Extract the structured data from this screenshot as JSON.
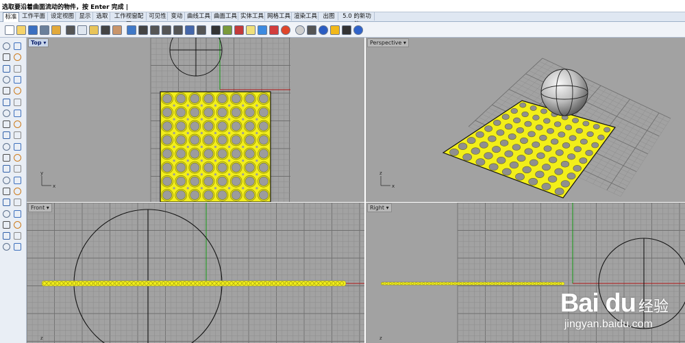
{
  "command_line": {
    "prompt": "选取要沿着曲面流动的物件，按 Enter 完成 |"
  },
  "tabs": [
    "标准",
    "工作平面",
    "设定视图",
    "显示",
    "选取",
    "工作视窗配置",
    "可见性",
    "变动",
    "曲线工具",
    "曲面工具",
    "实体工具",
    "网格工具",
    "渲染工具",
    "出图",
    "5.0 的新功能"
  ],
  "active_tab": "标准",
  "toolbar_icons": [
    "new-icon",
    "open-icon",
    "save-icon",
    "print-icon",
    "import-icon",
    "cut-icon",
    "copy-icon",
    "paste-icon",
    "undo-icon",
    "pan-hand-icon",
    "rotate-view-icon",
    "zoom-icon",
    "zoom-window-icon",
    "zoom-extents-icon",
    "zoom-selected-icon",
    "undo-view-icon",
    "set-view-icon",
    "camera-icon",
    "named-view-icon",
    "select-icon",
    "light-bulb-icon",
    "lock-icon",
    "layer-icon",
    "color-wheel-icon",
    "material-ball-icon",
    "render-icon",
    "rendered-sphere-icon",
    "curve-tools-icon",
    "grid-snap-icon",
    "help-icon"
  ],
  "toolbar_colors": [
    "#ffffff",
    "#f5d36a",
    "#3a6fc1",
    "#6a7f9a",
    "#e2a93b",
    "#555555",
    "#dfe6ef",
    "#e8c45a",
    "#444444",
    "#c9956a",
    "#3f78c7",
    "#444444",
    "#555555",
    "#555555",
    "#555555",
    "#4466aa",
    "#555555",
    "#333333",
    "#7a9a3b",
    "#c23a3a",
    "#f0e07a",
    "#3c8ae0",
    "#d23d3d",
    "#e0452a",
    "#cfcfcf",
    "#555555",
    "#2a5cc2",
    "#f2b81a",
    "#333333",
    "#2f62c9"
  ],
  "sidebar_icons": [
    "select-arrow-icon",
    "point-icon",
    "polyline-icon",
    "curve-icon",
    "circle-icon",
    "arc-icon",
    "ellipse-icon",
    "rectangle-icon",
    "polygon-icon",
    "freeform-icon",
    "fillet-icon",
    "offset-icon",
    "surface-icon",
    "extrude-icon",
    "box-icon",
    "sphere-icon",
    "cylinder-icon",
    "boolean-icon",
    "move-icon",
    "rotate-icon",
    "array-icon",
    "mirror-icon",
    "scale-icon",
    "join-icon",
    "explode-icon",
    "trim-icon",
    "split-icon",
    "cage-icon",
    "text-icon",
    "dimension-icon",
    "group-icon",
    "block-icon",
    "mesh-icon",
    "point-cloud-icon",
    "analyze-icon",
    "check-icon",
    "render-icon",
    "material-icon"
  ],
  "accent_colors": {
    "viewport_bg": "#a2a2a2",
    "grid_minor": "#8d8d8d",
    "grid_major": "#6f6f6f",
    "x_axis": "#b31515",
    "y_axis": "#139a13",
    "selection": "#f2ee1a"
  },
  "viewports": {
    "top": {
      "label": "Top",
      "active": true
    },
    "perspective": {
      "label": "Perspective",
      "active": false
    },
    "front": {
      "label": "Front",
      "active": false
    },
    "right": {
      "label": "Right",
      "active": false
    }
  },
  "axis_labels": {
    "x": "x",
    "y": "y",
    "z": "z"
  },
  "watermark": {
    "logo": "Bai du",
    "cn": "经验",
    "url": "jingyan.baidu.com"
  }
}
